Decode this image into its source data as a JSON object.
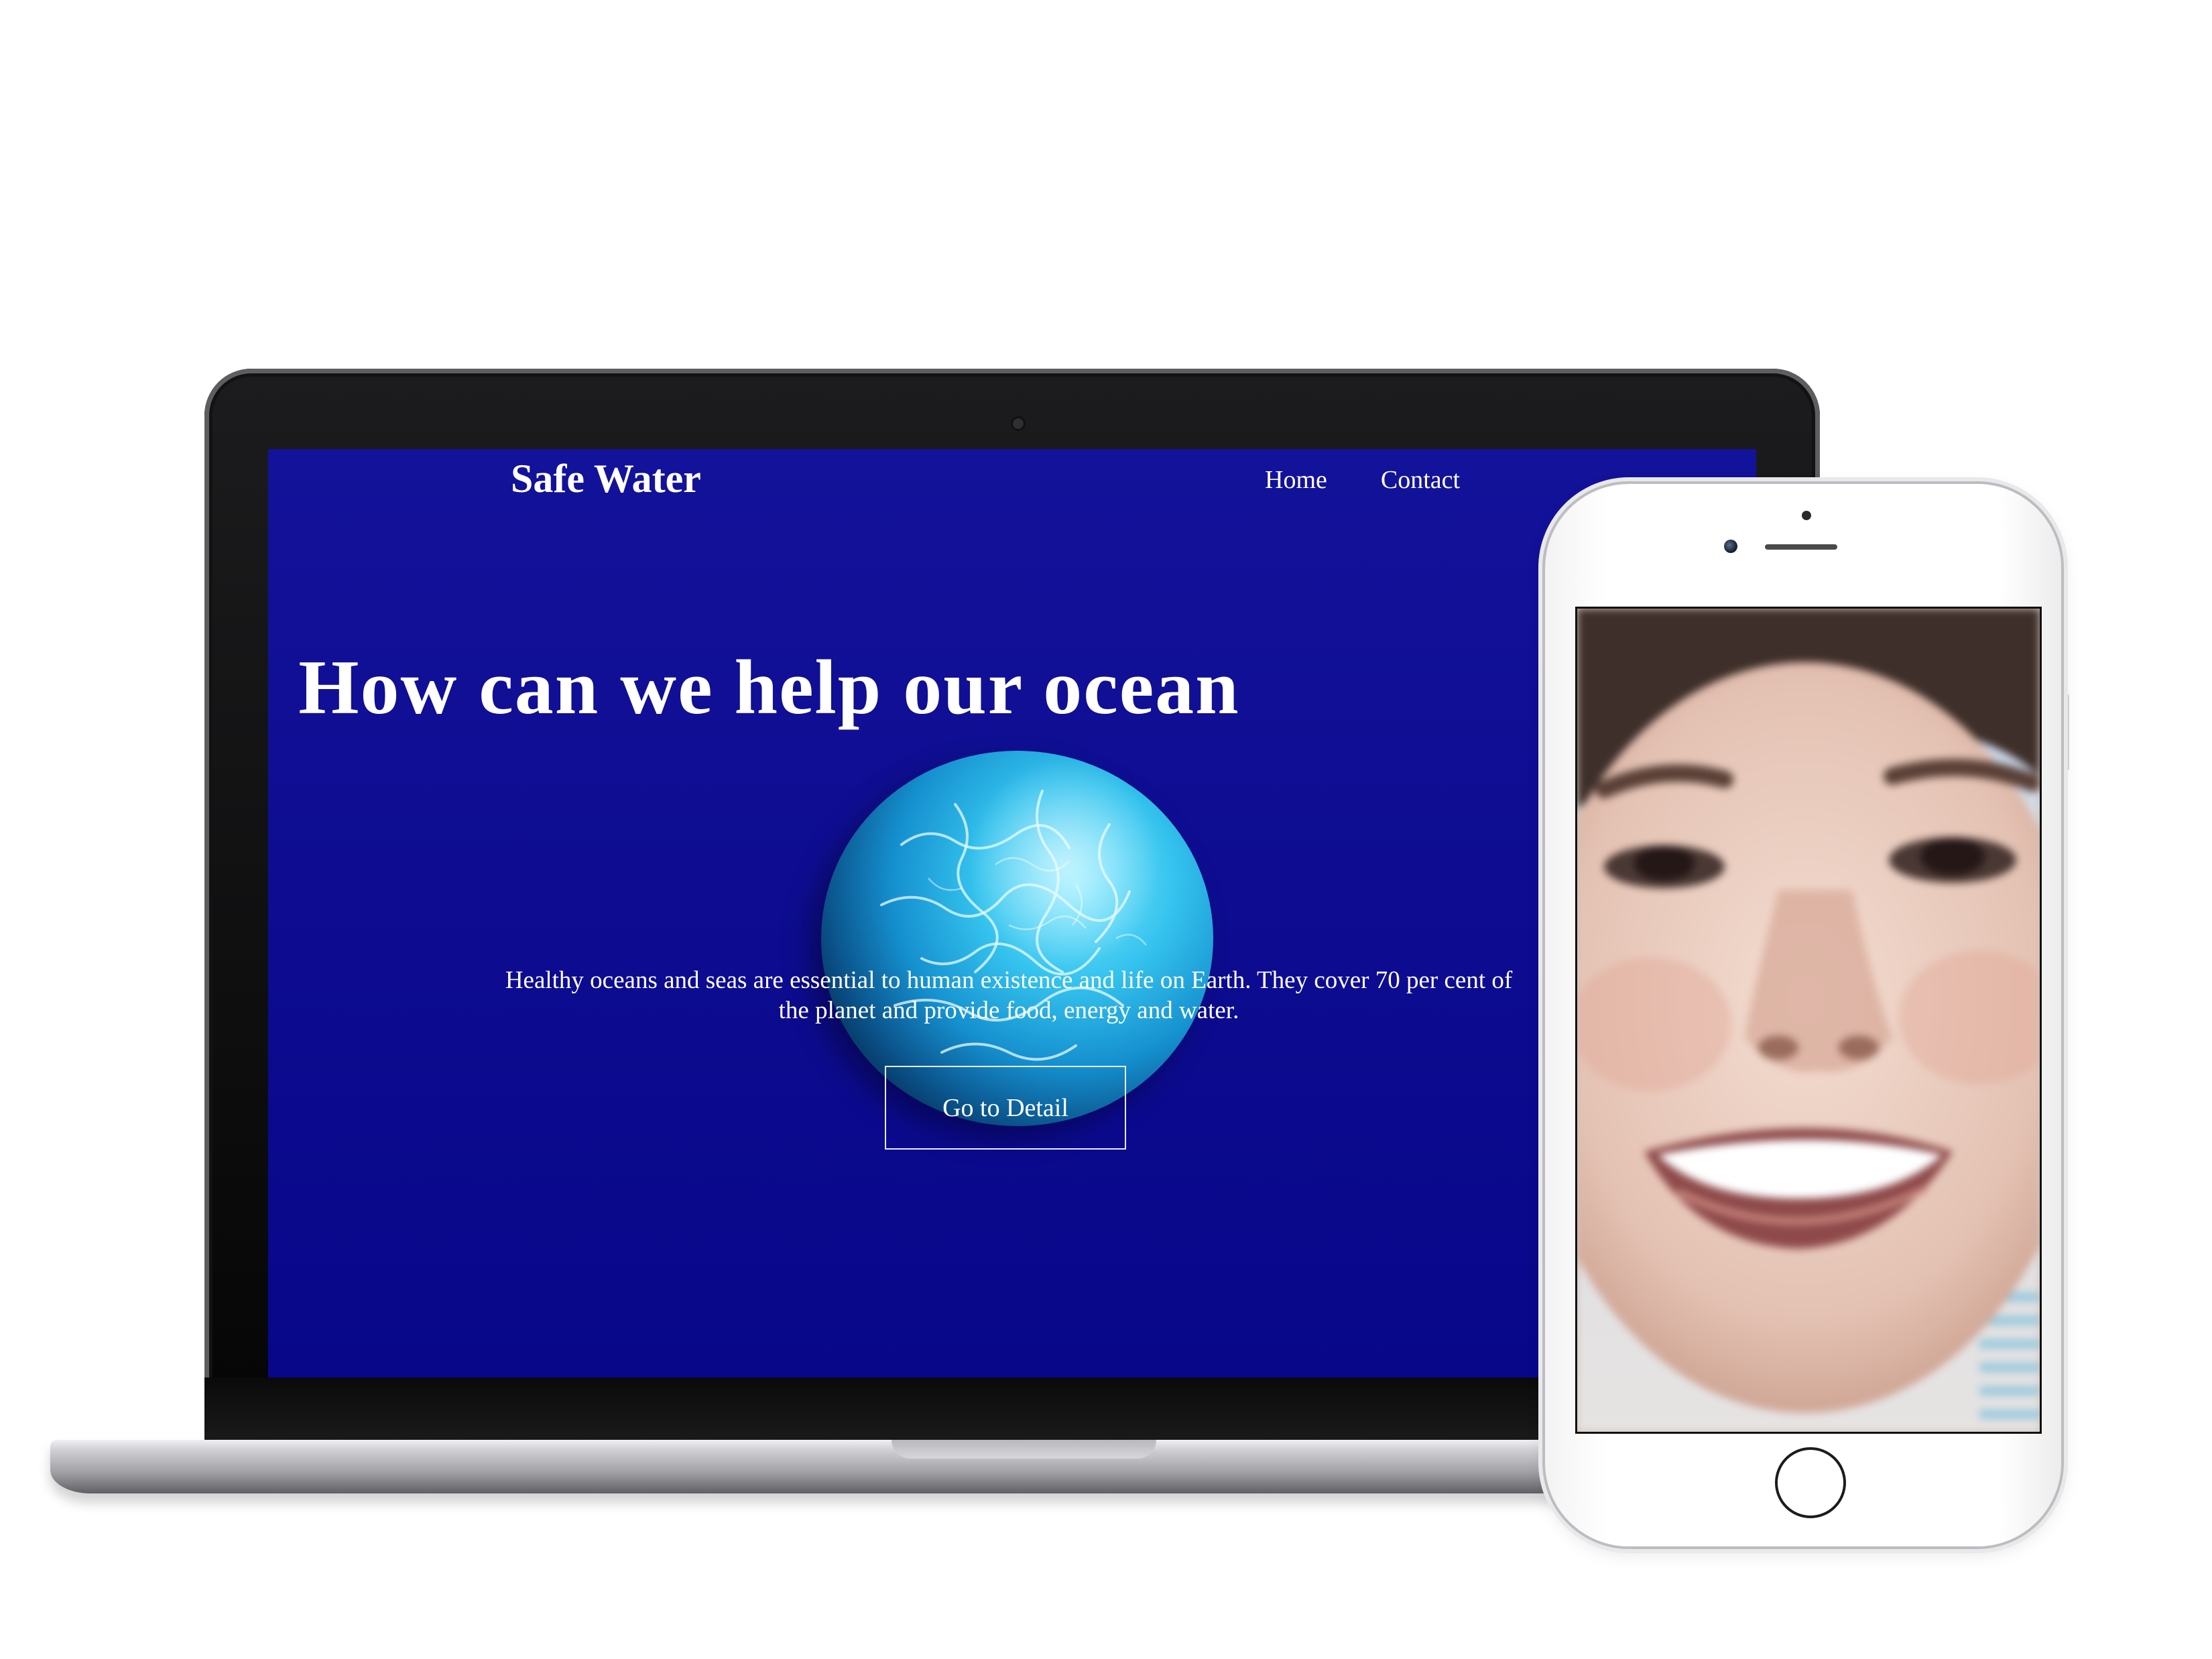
{
  "site": {
    "logo": "Safe Water",
    "nav": {
      "home": "Home",
      "contact": "Contact"
    },
    "hero": {
      "title": "How can we help our ocean",
      "text": "Healthy oceans and seas are essential to human existence and life on Earth. They cover 70 per cent of the planet and provide food, energy and water.",
      "button": "Go to Detail"
    }
  },
  "colors": {
    "site_background": "#0d0c90",
    "text": "#ffffff",
    "globe_water": "#35c3ee"
  },
  "icons": {
    "globe": "ocean-globe-image",
    "phone_photo": "smiling-face-photo"
  }
}
